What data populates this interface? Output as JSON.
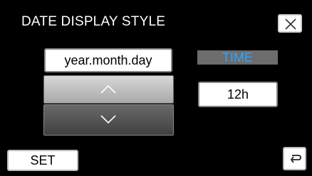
{
  "screen": {
    "title": "DATE DISPLAY STYLE"
  },
  "date_format": {
    "value": "year.month.day",
    "up_icon": "chevron-up-icon",
    "down_icon": "chevron-down-icon"
  },
  "time": {
    "label": "TIME",
    "label_color": "#30a4ff",
    "hour_format": "12h"
  },
  "footer": {
    "set_label": "SET",
    "back_icon": "return-arrow-icon",
    "close_icon": "close-icon"
  }
}
